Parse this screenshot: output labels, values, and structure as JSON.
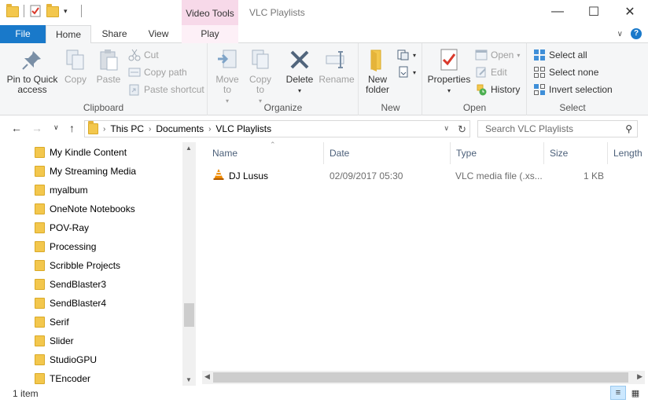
{
  "window": {
    "title": "VLC Playlists",
    "contextual_tab_header": "Video Tools",
    "minimize": "—",
    "maximize": "☐",
    "close": "✕"
  },
  "ribbon_tabs": {
    "file": "File",
    "home": "Home",
    "share": "Share",
    "view": "View",
    "play": "Play",
    "expand": "∨",
    "help": "?"
  },
  "clipboard": {
    "label": "Clipboard",
    "pin": "Pin to Quick access",
    "copy": "Copy",
    "paste": "Paste",
    "cut": "Cut",
    "copy_path": "Copy path",
    "paste_shortcut": "Paste shortcut"
  },
  "organize": {
    "label": "Organize",
    "move_to": "Move to",
    "copy_to": "Copy to",
    "delete": "Delete",
    "rename": "Rename"
  },
  "new": {
    "label": "New",
    "new_folder": "New folder"
  },
  "open": {
    "label": "Open",
    "properties": "Properties",
    "open": "Open",
    "edit": "Edit",
    "history": "History"
  },
  "select": {
    "label": "Select",
    "select_all": "Select all",
    "select_none": "Select none",
    "invert_selection": "Invert selection"
  },
  "address": {
    "crumbs": [
      "This PC",
      "Documents",
      "VLC Playlists"
    ],
    "search_placeholder": "Search VLC Playlists"
  },
  "nav_pane": {
    "items": [
      "My Kindle Content",
      "My Streaming Media",
      "myalbum",
      "OneNote Notebooks",
      "POV-Ray",
      "Processing",
      "Scribble Projects",
      "SendBlaster3",
      "SendBlaster4",
      "Serif",
      "Slider",
      "StudioGPU",
      "TEncoder"
    ]
  },
  "file_list": {
    "columns": {
      "name": "Name",
      "date": "Date",
      "type": "Type",
      "size": "Size",
      "length": "Length"
    },
    "rows": [
      {
        "name": "DJ Lusus",
        "date": "02/09/2017 05:30",
        "type": "VLC media file (.xs...",
        "size": "1 KB"
      }
    ]
  },
  "status": {
    "item_count": "1 item"
  },
  "colors": {
    "file_tab": "#1979ca",
    "contextual_tab": "#f7d9e9",
    "folder": "#f3c74d",
    "vlc_orange": "#f08a00"
  }
}
